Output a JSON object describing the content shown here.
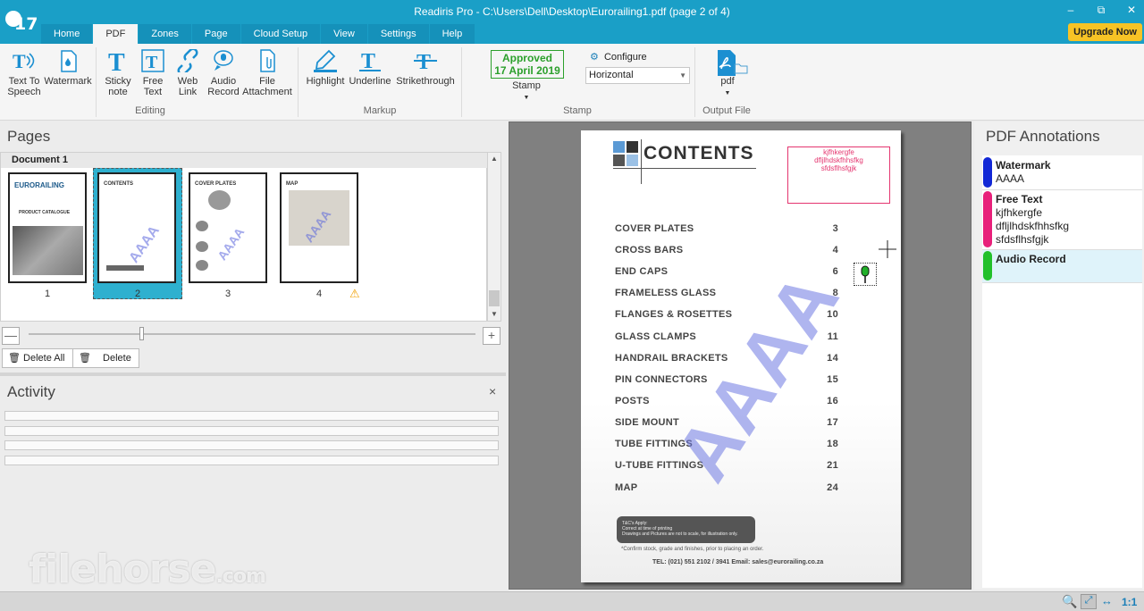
{
  "window": {
    "title": "Readiris Pro - C:\\Users\\Dell\\Desktop\\Eurorailing1.pdf (page 2 of 4)",
    "logo_text": "17",
    "upgrade_label": "Upgrade Now"
  },
  "tabs": [
    "Home",
    "PDF",
    "Zones",
    "Page",
    "Cloud Setup",
    "View",
    "Settings",
    "Help"
  ],
  "active_tab": "PDF",
  "ribbon": {
    "editing": {
      "group_label": "Editing",
      "buttons": [
        "Text To\nSpeech",
        "Watermark",
        "Sticky\nnote",
        "Free\nText",
        "Web\nLink",
        "Audio\nRecord",
        "File\nAttachment"
      ]
    },
    "markup": {
      "group_label": "Markup",
      "buttons": [
        "Highlight",
        "Underline",
        "Strikethrough"
      ]
    },
    "stamp": {
      "group_label": "Stamp",
      "stamp_line1": "Approved",
      "stamp_line2": "17 April 2019",
      "stamp_button": "Stamp",
      "configure_label": "Configure",
      "orientation": "Horizontal"
    },
    "output": {
      "group_label": "Output File",
      "format": "pdf"
    }
  },
  "pages_panel": {
    "title": "Pages",
    "document_label": "Document 1",
    "pages": [
      "1",
      "2",
      "3",
      "4"
    ],
    "thumb_titles": [
      "EURORAILING",
      "CONTENTS",
      "COVER PLATES",
      "MAP"
    ],
    "thumb_catalogue": "PRODUCT CATALOGUE",
    "thumb_watermark": "AAAA",
    "selected_page": "2",
    "delete_all_label": "Delete All",
    "delete_label": "Delete"
  },
  "activity_panel": {
    "title": "Activity",
    "close_symbol": "×"
  },
  "document": {
    "heading": "CONTENTS",
    "free_text": [
      "kjfhkergfe",
      "dfljlhdskfhhsfkg",
      "sfdsflhsfgjk"
    ],
    "watermark": "AAAA",
    "toc": [
      {
        "label": "COVER PLATES",
        "page": "3"
      },
      {
        "label": "CROSS BARS",
        "page": "4"
      },
      {
        "label": "END CAPS",
        "page": "6"
      },
      {
        "label": "FRAMELESS GLASS",
        "page": "8"
      },
      {
        "label": "FLANGES & ROSETTES",
        "page": "10"
      },
      {
        "label": "GLASS CLAMPS",
        "page": "11"
      },
      {
        "label": "HANDRAIL BRACKETS",
        "page": "14"
      },
      {
        "label": "PIN CONNECTORS",
        "page": "15"
      },
      {
        "label": "POSTS",
        "page": "16"
      },
      {
        "label": "SIDE MOUNT",
        "page": "17"
      },
      {
        "label": "TUBE FITTINGS",
        "page": "18"
      },
      {
        "label": "U-TUBE FITTINGS",
        "page": "21"
      },
      {
        "label": "MAP",
        "page": "24"
      }
    ],
    "note_lines": [
      "T&C's Apply:",
      "Correct at time of printing",
      "Drawings and Pictures are not to scale, for illustration only."
    ],
    "confirm_note": "*Confirm stock, grade and finishes, prior to placing an order.",
    "contact": "TEL: (021) 551  2102 / 3941  Email: sales@eurorailing.co.za"
  },
  "annotations_panel": {
    "title": "PDF Annotations",
    "items": [
      {
        "type": "Watermark",
        "content": "AAAA",
        "color": "#1228d6"
      },
      {
        "type": "Free Text",
        "content_lines": [
          "kjfhkergfe",
          "dfljlhdskfhhsfkg",
          "sfdsflhsfgjk"
        ],
        "color": "#e8207a"
      },
      {
        "type": "Audio Record",
        "content": "",
        "color": "#22c02a"
      }
    ]
  },
  "status": {
    "zoom_label": "1:1"
  },
  "watermark_brand": {
    "main": "filehorse",
    "suffix": ".com"
  },
  "colors": {
    "accent": "#1a9fc7",
    "upgrade": "#f7c325",
    "thumb_selected": "#2eb0cf"
  }
}
